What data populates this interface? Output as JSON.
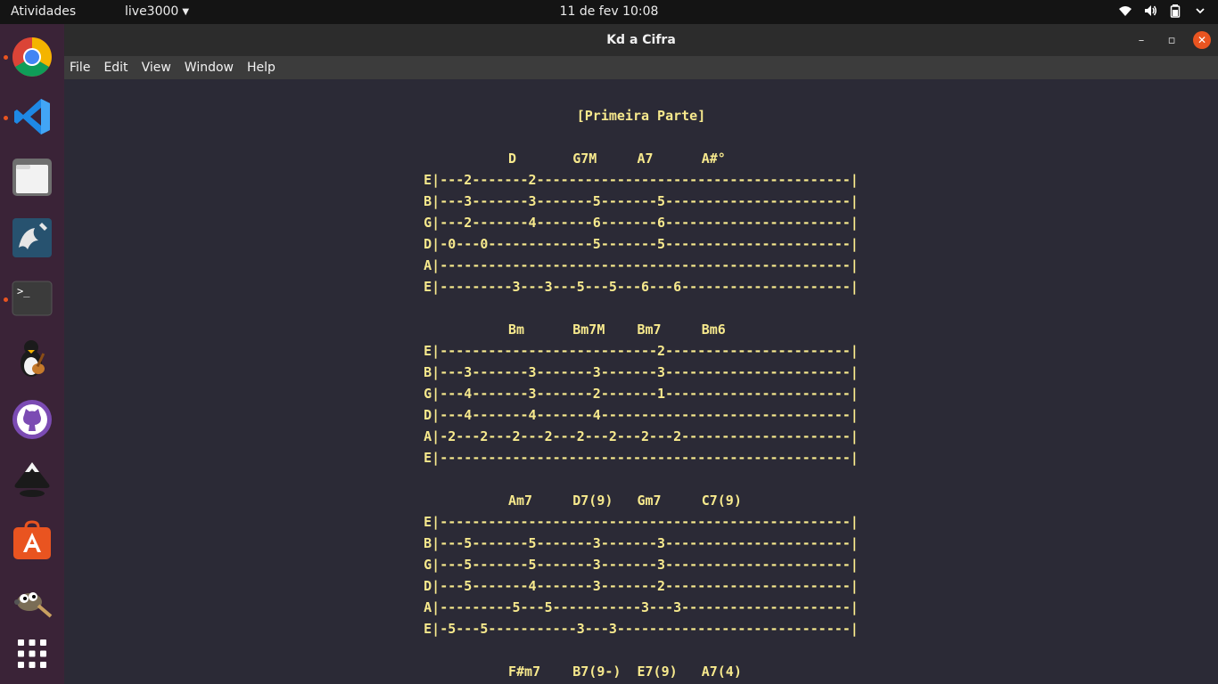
{
  "topbar": {
    "activities": "Atividades",
    "app_menu": "live3000",
    "clock": "11 de fev  10:08"
  },
  "dock": {
    "items": [
      {
        "icon": "chrome-icon",
        "running": true
      },
      {
        "icon": "vscode-icon",
        "running": true
      },
      {
        "icon": "files-icon",
        "running": false
      },
      {
        "icon": "mysql-workbench-icon",
        "running": false
      },
      {
        "icon": "terminal-icon",
        "running": true
      },
      {
        "icon": "tux-guitar-icon",
        "running": false
      },
      {
        "icon": "github-icon",
        "running": false
      },
      {
        "icon": "inkscape-icon",
        "running": false
      },
      {
        "icon": "app-store-icon",
        "running": false
      },
      {
        "icon": "gimp-icon",
        "running": false
      },
      {
        "icon": "show-apps-icon",
        "running": false
      }
    ]
  },
  "window": {
    "title": "Kd a Cifra",
    "menu": [
      "File",
      "Edit",
      "View",
      "Window",
      "Help"
    ]
  },
  "colors": {
    "accent": "#e95420",
    "tab_text": "#f7e98d",
    "content_bg": "#2b2a36"
  },
  "tab": {
    "lines": [
      "[Primeira Parte]",
      "",
      "          D       G7M     A7      A#°                ",
      "E|---2-------2---------------------------------------|",
      "B|---3-------3-------5-------5-----------------------|",
      "G|---2-------4-------6-------6-----------------------|",
      "D|-0---0-------------5-------5-----------------------|",
      "A|---------------------------------------------------|",
      "E|---------3---3---5---5---6---6---------------------|",
      "",
      "          Bm      Bm7M    Bm7     Bm6                ",
      "E|---------------------------2-----------------------|",
      "B|---3-------3-------3-------3-----------------------|",
      "G|---4-------3-------2-------1-----------------------|",
      "D|---4-------4-------4-------------------------------|",
      "A|-2---2---2---2---2---2---2---2---------------------|",
      "E|---------------------------------------------------|",
      "",
      "          Am7     D7(9)   Gm7     C7(9)              ",
      "E|---------------------------------------------------|",
      "B|---5-------5-------3-------3-----------------------|",
      "G|---5-------5-------3-------3-----------------------|",
      "D|---5-------4-------3-------2-----------------------|",
      "A|---------5---5-----------3---3---------------------|",
      "E|-5---5-----------3---3-----------------------------|",
      "",
      "          F#m7    B7(9-)  E7(9)   A7(4)              "
    ]
  }
}
